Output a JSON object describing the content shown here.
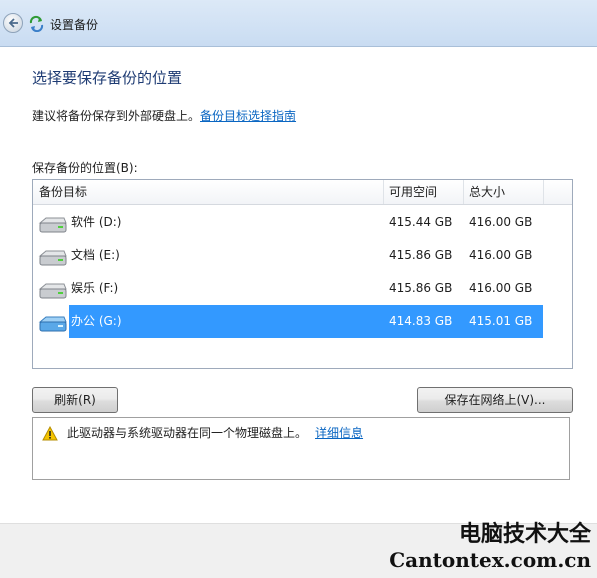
{
  "window": {
    "title": "设置备份"
  },
  "page": {
    "heading": "选择要保存备份的位置",
    "advice": "建议将备份保存到外部硬盘上。",
    "advice_link": "备份目标选择指南",
    "location_label": "保存备份的位置(B):"
  },
  "table": {
    "columns": [
      "备份目标",
      "可用空间",
      "总大小"
    ],
    "rows": [
      {
        "name": "软件 (D:)",
        "free": "415.44 GB",
        "total": "416.00 GB",
        "selected": false
      },
      {
        "name": "文档 (E:)",
        "free": "415.86 GB",
        "total": "416.00 GB",
        "selected": false
      },
      {
        "name": "娱乐 (F:)",
        "free": "415.86 GB",
        "total": "416.00 GB",
        "selected": false
      },
      {
        "name": "办公 (G:)",
        "free": "414.83 GB",
        "total": "415.01 GB",
        "selected": true
      }
    ]
  },
  "buttons": {
    "refresh": "刷新(R)",
    "save_network": "保存在网络上(V)..."
  },
  "warning": {
    "text": "此驱动器与系统驱动器在同一个物理磁盘上。",
    "link": "详细信息"
  },
  "watermark": {
    "line1": "电脑技术大全",
    "line2": "Cantontex.com.cn"
  },
  "colors": {
    "selection": "#3399ff",
    "link": "#0a66c2",
    "heading": "#1e3b73"
  }
}
